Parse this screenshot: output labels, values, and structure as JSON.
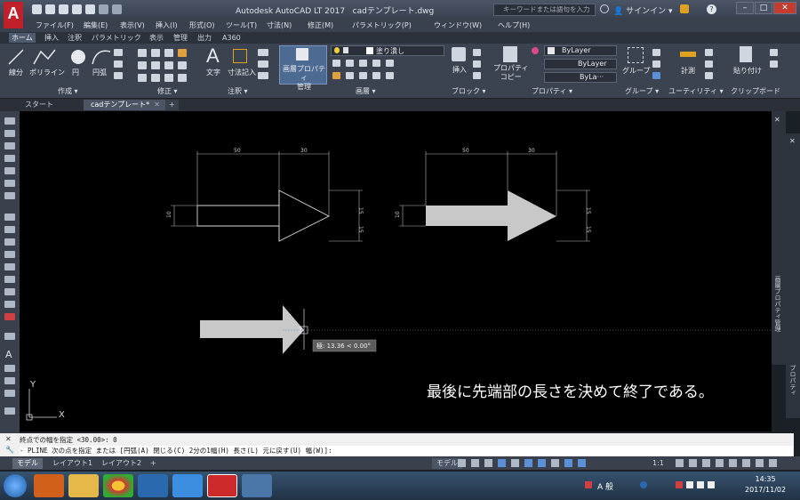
{
  "titlebar": {
    "app_title": "Autodesk AutoCAD LT 2017",
    "file_name": "cadテンプレート.dwg",
    "search_placeholder": "キーワードまたは語句を入力",
    "signin": "サインイン"
  },
  "menu": [
    "ファイル(F)",
    "編集(E)",
    "表示(V)",
    "挿入(I)",
    "形式(O)",
    "ツール(T)",
    "寸法(N)",
    "修正(M)",
    "パラメトリック(P)",
    "ウィンドウ(W)",
    "ヘルプ(H)"
  ],
  "ribbon_tabs": [
    "ホーム",
    "挿入",
    "注釈",
    "パラメトリック",
    "表示",
    "管理",
    "出力",
    "A360"
  ],
  "ribbon": {
    "draw": {
      "line": "線分",
      "polyline": "ポリライン",
      "circle": "円",
      "arc": "円弧",
      "panel": "作成 ▾"
    },
    "modify": {
      "panel": "修正 ▾"
    },
    "annotation": {
      "text": "文字",
      "dimension": "寸法記入",
      "panel": "注釈 ▾"
    },
    "layers": {
      "properties_btn": "画層プロパティ\n管理",
      "layer_name": "塗り潰し",
      "panel": "画層 ▾"
    },
    "block": {
      "insert": "挿入",
      "panel": "ブロック ▾"
    },
    "properties": {
      "match": "プロパティ\nコピー",
      "bylayer1": "ByLayer",
      "bylayer2": "ByLayer",
      "bylayer3": "ByLa···",
      "panel": "プロパティ ▾"
    },
    "groups": {
      "group": "グループ",
      "panel": "グループ ▾"
    },
    "utilities": {
      "measure": "計測",
      "panel": "ユーティリティ ▾"
    },
    "clipboard": {
      "paste": "貼り付け",
      "panel": "クリップボード"
    }
  },
  "file_tabs": {
    "start": "スタート",
    "active": "cadテンプレート*"
  },
  "drawing": {
    "dim_50_a": "50",
    "dim_30_a": "30",
    "dim_10_a": "10",
    "dim_15_a1": "15",
    "dim_15_a2": "15",
    "dim_50_b": "50",
    "dim_30_b": "30",
    "dim_10_b": "10",
    "dim_15_b1": "15",
    "dim_15_b2": "15",
    "polar_tooltip": "極: 13.36 < 0.00°",
    "caption": "最後に先端部の長さを決めて終了である。",
    "ucs_x": "X",
    "ucs_y": "Y"
  },
  "right_palettes": {
    "properties_manager": "画層プロパティ管理",
    "properties": "プロパティ"
  },
  "command": {
    "history": "終点での幅を指定 <30.00>: 0",
    "prompt": "- PLINE 次の点を指定 または [円弧(A) 閉じる(C) 2分の1幅(H) 長さ(L) 元に戻す(U) 幅(W)]:"
  },
  "status_tabs": [
    "モデル",
    "レイアウト1",
    "レイアウト2"
  ],
  "status_right": {
    "model": "モデル",
    "scale": "1:1"
  },
  "taskbar": {
    "ime": "A 般",
    "time": "14:35",
    "date": "2017/11/02"
  },
  "colors": {
    "accent_red": "#c0202a",
    "ribbon_bg": "#3b4350",
    "canvas_bg": "#000000",
    "arrow_fill": "#c8c8c8"
  }
}
